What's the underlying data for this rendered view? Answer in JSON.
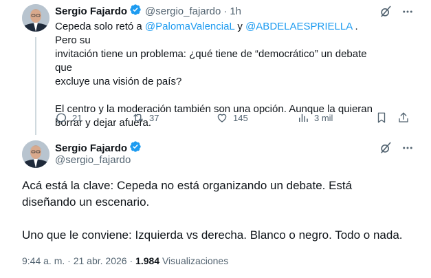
{
  "tweet1": {
    "author_name": "Sergio Fajardo",
    "handle": "@sergio_fajardo",
    "separator": "·",
    "time": "1h",
    "line1_pre": "Cepeda solo retó a ",
    "mention1": "@PalomaValenciaL",
    "line1_mid": " y ",
    "mention2": "@ABDELAESPRIELLA",
    "line1_post": " . Pero su",
    "line2": "invitación tiene un problema: ¿qué tiene de “democrático” un debate que",
    "line3": "excluye una visión de país?",
    "para2_line1": "El centro y la moderación también son una opción. Aunque la quieran",
    "para2_line2": "borrar y dejar afuera.",
    "replies": "21",
    "reposts": "37",
    "likes": "145",
    "views": "3 mil"
  },
  "tweet2": {
    "author_name": "Sergio Fajardo",
    "handle": "@sergio_fajardo",
    "para1_line1": "Acá está la clave: Cepeda no está organizando un debate. Está",
    "para1_line2": "diseñando un escenario.",
    "para2": "Uno que le conviene: Izquierda vs derecha. Blanco o negro. Todo o nada.",
    "time": "9:44 a. m.",
    "sep1": " · ",
    "date": "21 abr. 2026",
    "sep2": " · ",
    "views_count": "1.984",
    "views_label": " Visualizaciones"
  },
  "colors": {
    "accent": "#1d9bf0",
    "text": "#0f1419",
    "muted": "#536471"
  },
  "icons": [
    "reply-icon",
    "repost-icon",
    "like-icon",
    "views-icon",
    "bookmark-icon",
    "share-icon",
    "grok-icon",
    "more-icon",
    "verified-badge-icon"
  ]
}
